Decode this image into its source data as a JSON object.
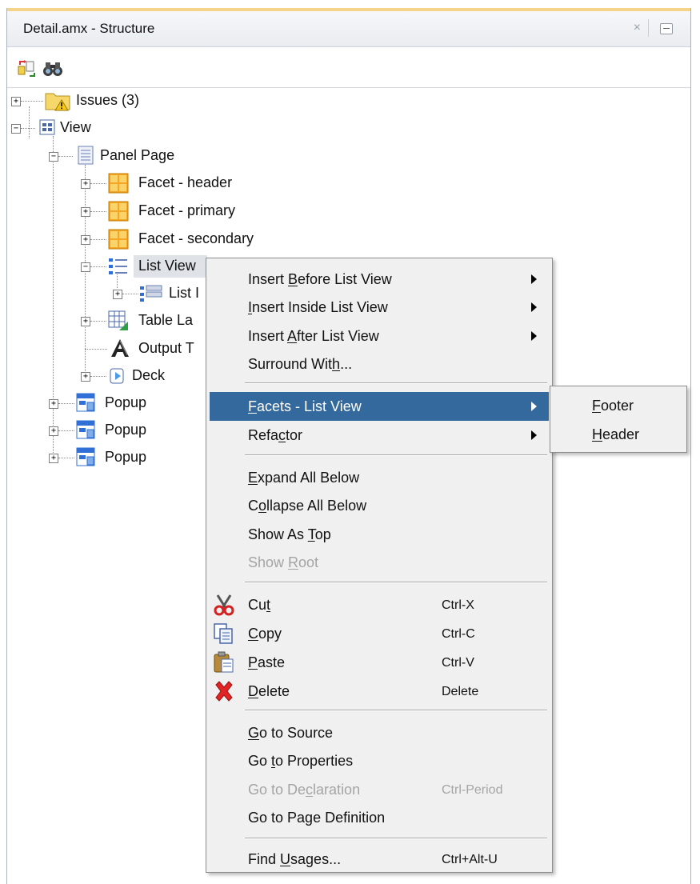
{
  "panel": {
    "title": "Detail.amx - Structure",
    "close_glyph": "×"
  },
  "toolbar": [
    {
      "icon": "synchronize-with-editor-icon"
    },
    {
      "icon": "find-binoculars-icon"
    }
  ],
  "tree": {
    "issues": "Issues (3)",
    "view": "View",
    "panel_page": "Panel Page",
    "facet_header": "Facet - header",
    "facet_primary": "Facet - primary",
    "facet_secondary": "Facet - secondary",
    "list_view": "List View",
    "list_item": "List I",
    "table_layout": "Table La",
    "output_text": "Output T",
    "deck": "Deck",
    "popup_1": "Popup",
    "popup_2": "Popup",
    "popup_3": "Popup"
  },
  "context_menu": {
    "insert_before": {
      "pre": "Insert ",
      "key": "B",
      "post": "efore List View"
    },
    "insert_inside": {
      "pre": "",
      "key": "I",
      "post": "nsert Inside List View"
    },
    "insert_after": {
      "pre": "Insert ",
      "key": "A",
      "post": "fter List View"
    },
    "surround_with": {
      "pre": "Surround Wit",
      "key": "h",
      "post": "..."
    },
    "facets": {
      "pre": "",
      "key": "F",
      "post": "acets - List View"
    },
    "refactor": {
      "pre": "Refa",
      "key": "c",
      "post": "tor"
    },
    "expand_all": {
      "pre": "",
      "key": "E",
      "post": "xpand All Below"
    },
    "collapse_all": {
      "pre": "C",
      "key": "o",
      "post": "llapse All Below"
    },
    "show_as_top": {
      "pre": "Show As ",
      "key": "T",
      "post": "op"
    },
    "show_root": {
      "pre": "Show ",
      "key": "R",
      "post": "oot"
    },
    "cut": {
      "pre": "Cu",
      "key": "t",
      "post": "",
      "shortcut": "Ctrl-X"
    },
    "copy": {
      "pre": "",
      "key": "C",
      "post": "opy",
      "shortcut": "Ctrl-C"
    },
    "paste": {
      "pre": "",
      "key": "P",
      "post": "aste",
      "shortcut": "Ctrl-V"
    },
    "delete": {
      "pre": "",
      "key": "D",
      "post": "elete",
      "shortcut": "Delete"
    },
    "go_to_source": {
      "pre": "",
      "key": "G",
      "post": "o to Source"
    },
    "go_to_properties": {
      "pre": "Go ",
      "key": "t",
      "post": "o Properties"
    },
    "go_to_declaration": {
      "pre": "Go to De",
      "key": "c",
      "post": "laration",
      "shortcut": "Ctrl-Period"
    },
    "go_to_page_definition": {
      "pre": "Go to Pa",
      "key": "g",
      "post": "e Definition"
    },
    "find_usages": {
      "pre": "Find ",
      "key": "U",
      "post": "sages...",
      "shortcut": "Ctrl+Alt-U"
    }
  },
  "submenu": {
    "footer": {
      "key": "F",
      "post": "ooter"
    },
    "header": {
      "key": "H",
      "post": "eader"
    }
  },
  "colors": {
    "highlight": "#34699d",
    "menu_bg": "#f0f0f0",
    "disabled_text": "#a4a4a4"
  }
}
